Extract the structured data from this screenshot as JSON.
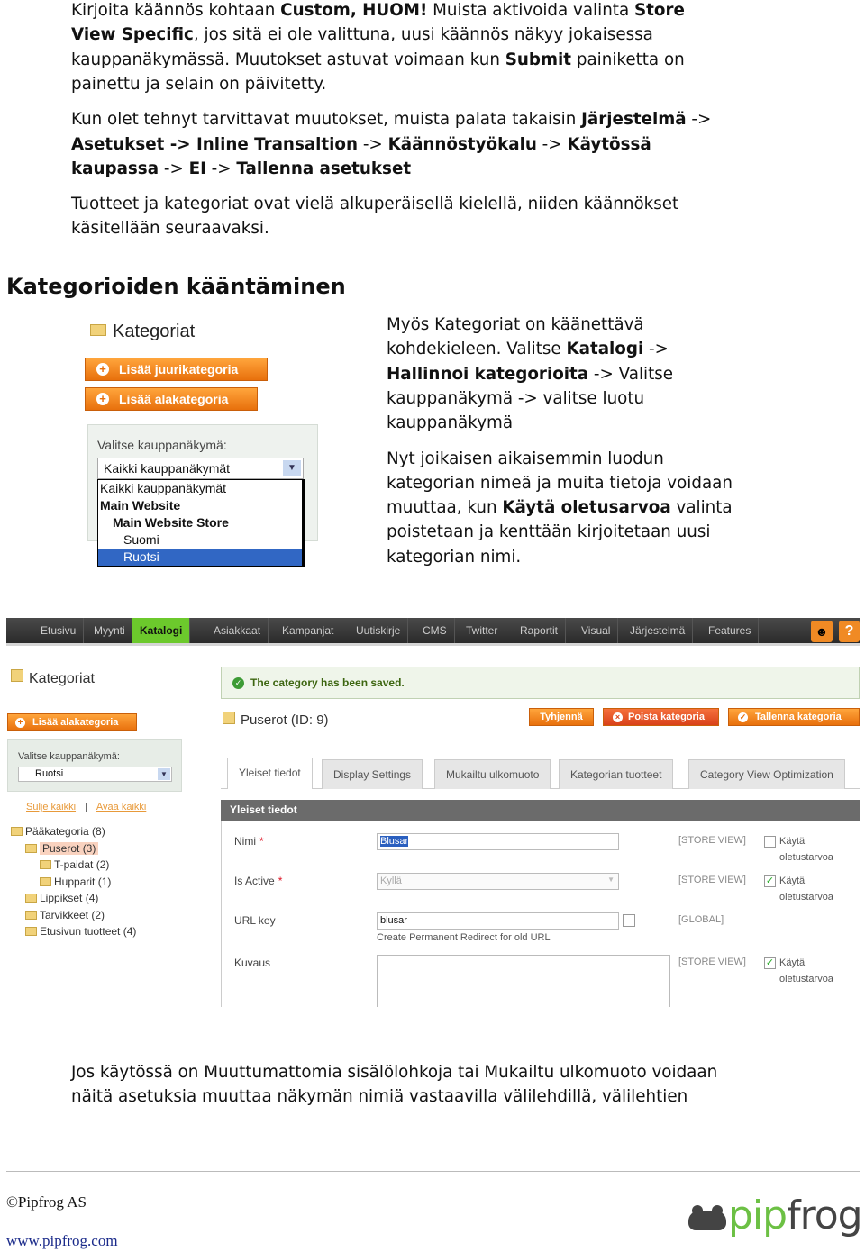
{
  "intro": [
    [
      [
        {
          "t": "Kirjoita käännös kohtaan "
        },
        {
          "t": "Custom, HUOM!",
          "b": 1
        },
        {
          "t": " Muista aktivoida valinta "
        },
        {
          "t": "Store",
          "b": 1
        }
      ],
      [
        {
          "t": "View Specific",
          "b": 1
        },
        {
          "t": ", jos sitä ei ole valittuna, uusi käännös näkyy jokaisessa"
        }
      ],
      [
        {
          "t": "kauppanäkymässä. Muutokset astuvat voimaan kun "
        },
        {
          "t": "Submit",
          "b": 1
        },
        {
          "t": " painiketta on"
        }
      ],
      [
        {
          "t": "painettu ja selain on päivitetty."
        }
      ]
    ],
    [
      [
        {
          "t": "Kun  olet tehnyt tarvittavat muutokset, muista palata takaisin "
        },
        {
          "t": "Järjestelmä",
          "b": 1
        },
        {
          "t": " ->"
        }
      ],
      [
        {
          "t": "Asetukset -> Inline Transaltion",
          "b": 1
        },
        {
          "t": " -> "
        },
        {
          "t": "Käännöstyökalu",
          "b": 1
        },
        {
          "t": " -> "
        },
        {
          "t": "Käytössä",
          "b": 1
        }
      ],
      [
        {
          "t": "kaupassa",
          "b": 1
        },
        {
          "t": " -> "
        },
        {
          "t": "EI",
          "b": 1
        },
        {
          "t": " -> "
        },
        {
          "t": "Tallenna asetukset",
          "b": 1
        }
      ]
    ],
    [
      [
        {
          "t": "Tuotteet ja kategoriat ovat vielä alkuperäisellä kielellä, niiden käännökset"
        }
      ],
      [
        {
          "t": "käsitellään seuraavaksi."
        }
      ]
    ]
  ],
  "heading": "Kategorioiden kääntäminen",
  "side": [
    [
      [
        {
          "t": "Myös Kategoriat on  käänettävä"
        }
      ],
      [
        {
          "t": "kohdekieleen. Valitse "
        },
        {
          "t": "Katalogi",
          "b": 1
        },
        {
          "t": " ->"
        }
      ],
      [
        {
          "t": "Hallinnoi kategorioita",
          "b": 1
        },
        {
          "t": " -> Valitse"
        }
      ],
      [
        {
          "t": "kauppanäkymä -> valitse luotu"
        }
      ],
      [
        {
          "t": "kauppanäkymä"
        }
      ]
    ],
    [
      [
        {
          "t": "Nyt joikaisen aikaisemmin luodun"
        }
      ],
      [
        {
          "t": "kategorian nimeä ja muita tietoja voidaan"
        }
      ],
      [
        {
          "t": "muuttaa, kun "
        },
        {
          "t": "Käytä oletusarvoa",
          "b": 1
        },
        {
          "t": " valinta"
        }
      ],
      [
        {
          "t": "poistetaan ja kenttään kirjoitetaan uusi"
        }
      ],
      [
        {
          "t": "kategorian nimi."
        }
      ]
    ]
  ],
  "small_shot": {
    "title": "Kategoriat",
    "btn_root": "Lisää juurikategoria",
    "btn_sub": "Lisää alakategoria",
    "store_label": "Valitse kauppanäkymä:",
    "select_value": "Kaikki kauppanäkymät",
    "options": [
      "Kaikki kauppanäkymät",
      "Main Website",
      "Main Website Store",
      "Suomi",
      "Ruotsi"
    ],
    "selected_option": "Ruotsi"
  },
  "admin": {
    "nav": [
      "Etusivu",
      "Myynti",
      "Katalogi",
      "Asiakkaat",
      "Kampanjat",
      "Uutiskirje",
      "CMS",
      "Twitter",
      "Raportit",
      "Visual",
      "Järjestelmä",
      "Features"
    ],
    "nav_active": "Katalogi",
    "accent": "#6cc92c",
    "title": "Kategoriat",
    "success": "The category has been saved.",
    "btn_sub": "Lisää alakategoria",
    "store_label": "Valitse kauppanäkymä:",
    "store_value": "Ruotsi",
    "collapse_all": "Sulje kaikki",
    "sep": "|",
    "expand_all": "Avaa kaikki",
    "tree": [
      "Pääkategoria (8)",
      "Puserot (3)",
      "T-paidat (2)",
      "Hupparit (1)",
      "Lippikset (4)",
      "Tarvikkeet (2)",
      "Etusivun tuotteet (4)"
    ],
    "cat_title": "Puserot (ID: 9)",
    "btn_reset": "Tyhjennä",
    "btn_delete": "Poista kategoria",
    "btn_save": "Tallenna kategoria",
    "tabs": [
      "Yleiset tiedot",
      "Display Settings",
      "Mukailtu ulkomuoto",
      "Kategorian tuotteet",
      "Category View Optimization"
    ],
    "section": "Yleiset tiedot",
    "fields": {
      "name_label": "Nimi",
      "name_value": "Blusar",
      "active_label": "Is Active",
      "active_value": "Kyllä",
      "url_label": "URL key",
      "url_value": "blusar",
      "redirect": "Create Permanent Redirect for old URL",
      "desc_label": "Kuvaus",
      "store_view": "[STORE VIEW]",
      "global": "[GLOBAL]",
      "use_default": "Käytä oletustarvoa"
    }
  },
  "bottom": [
    [
      [
        {
          "t": "Jos käytössä on Muuttumattomia sisälölohkoja tai Mukailtu ulkomuoto voidaan"
        }
      ],
      [
        {
          "t": "näitä asetuksia muuttaa näkymän nimiä vastaavilla välilehdillä,  välilehtien"
        }
      ]
    ]
  ],
  "footer": {
    "copyright": "©Pipfrog AS",
    "link": "www.pipfrog.com",
    "logo_text": "pipfrog"
  }
}
